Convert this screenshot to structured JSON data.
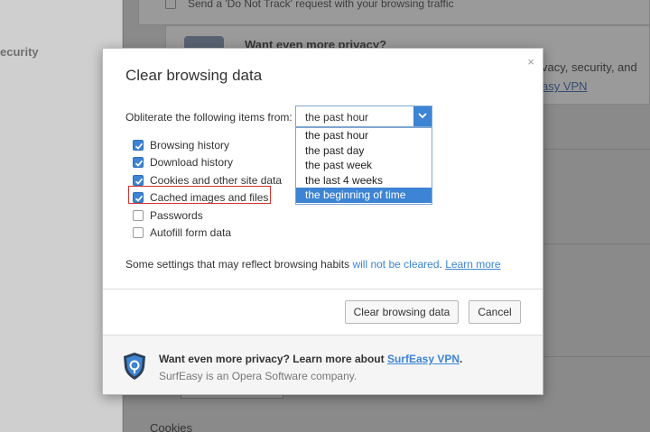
{
  "background": {
    "sidebar_label": "ecurity",
    "dnt_text": "Send a 'Do Not Track' request with your browsing traffic",
    "privacy_title": "Want even more privacy?",
    "privacy_text_1": "vacy, security, and",
    "privacy_link": "asy VPN",
    "cookies_heading": "Cookies"
  },
  "dialog": {
    "title": "Clear browsing data",
    "close_glyph": "×",
    "obliterate_label": "Obliterate the following items from:",
    "select_value": "the past hour",
    "dropdown_options": [
      "the past hour",
      "the past day",
      "the past week",
      "the last 4 weeks",
      "the beginning of time"
    ],
    "dropdown_selected": "the beginning of time",
    "items": [
      {
        "label": "Browsing history",
        "checked": true
      },
      {
        "label": "Download history",
        "checked": true
      },
      {
        "label": "Cookies and other site data",
        "checked": true
      },
      {
        "label": "Cached images and files",
        "checked": true
      },
      {
        "label": "Passwords",
        "checked": false
      },
      {
        "label": "Autofill form data",
        "checked": false
      }
    ],
    "note_prefix": "Some settings that may reflect browsing habits ",
    "note_blue": "will not be cleared",
    "note_sep": ". ",
    "note_link": "Learn more",
    "clear_button": "Clear browsing data",
    "cancel_button": "Cancel",
    "footer_line1_prefix": "Want even more privacy? Learn more about ",
    "footer_link": "SurfEasy VPN",
    "footer_line1_suffix": ".",
    "footer_line2": "SurfEasy is an Opera Software company."
  },
  "colors": {
    "accent": "#3d84d4",
    "highlight_box": "#d32f2f",
    "shield_dark": "#2d3e55"
  },
  "icons": [
    "close-icon",
    "dropdown-arrow-icon",
    "checkmark-icon",
    "surfeasy-shield-icon"
  ]
}
